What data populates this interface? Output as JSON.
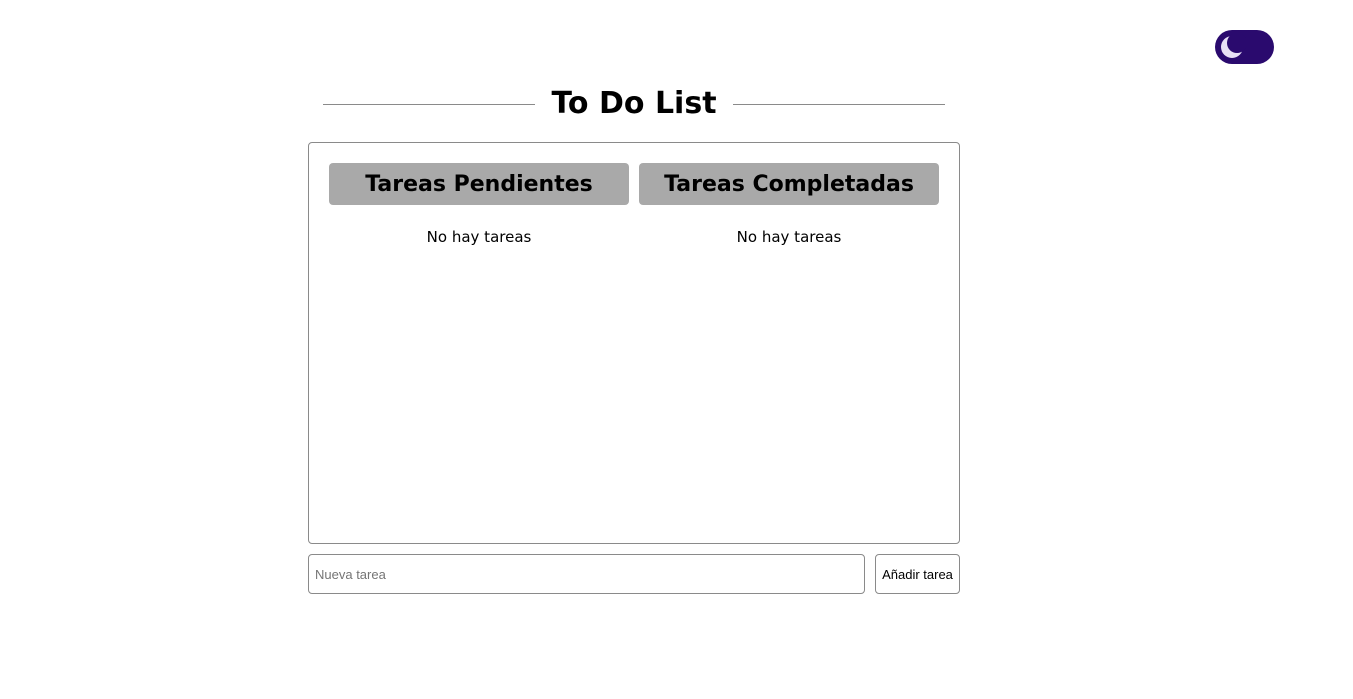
{
  "theme_toggle": {
    "icon": "moon-icon",
    "background_color": "#2a0a6e",
    "icon_color": "#e8e0f5"
  },
  "header": {
    "title": "To Do List"
  },
  "board": {
    "pending": {
      "header": "Tareas Pendientes",
      "empty_message": "No hay tareas"
    },
    "completed": {
      "header": "Tareas Completadas",
      "empty_message": "No hay tareas"
    },
    "header_color": "#a9a9a9"
  },
  "new_task": {
    "placeholder": "Nueva tarea",
    "value": "",
    "add_label": "Añadir tarea"
  }
}
